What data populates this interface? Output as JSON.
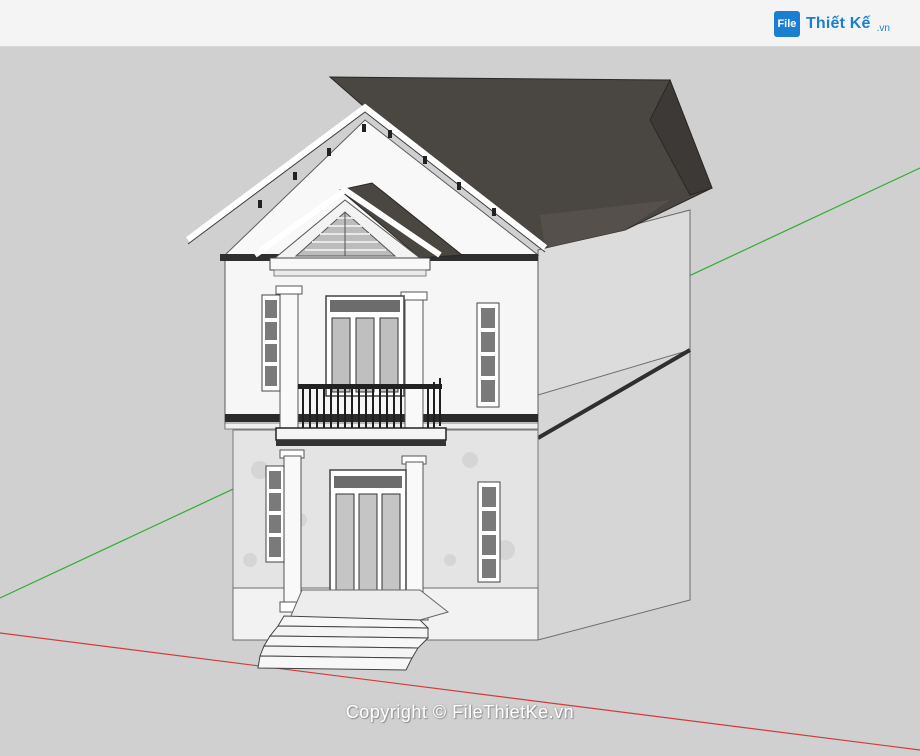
{
  "branding": {
    "logo_mark": "File",
    "logo_name": "Thiết Kế",
    "logo_suffix": ".vn"
  },
  "watermark": {
    "text": "Copyright © FileThietKe.vn"
  },
  "colors": {
    "viewport_bg": "#d0d0d0",
    "roof": "#4a4642",
    "wall_front": "#f6f6f6",
    "wall_side": "#d6d6d6",
    "stone": "#e4e4e4",
    "axis_green": "#2fae2f",
    "axis_red": "#d23b3b",
    "brand_blue": "#1b7fd1"
  },
  "icons": {
    "logo": "filethietke-logo-icon"
  }
}
